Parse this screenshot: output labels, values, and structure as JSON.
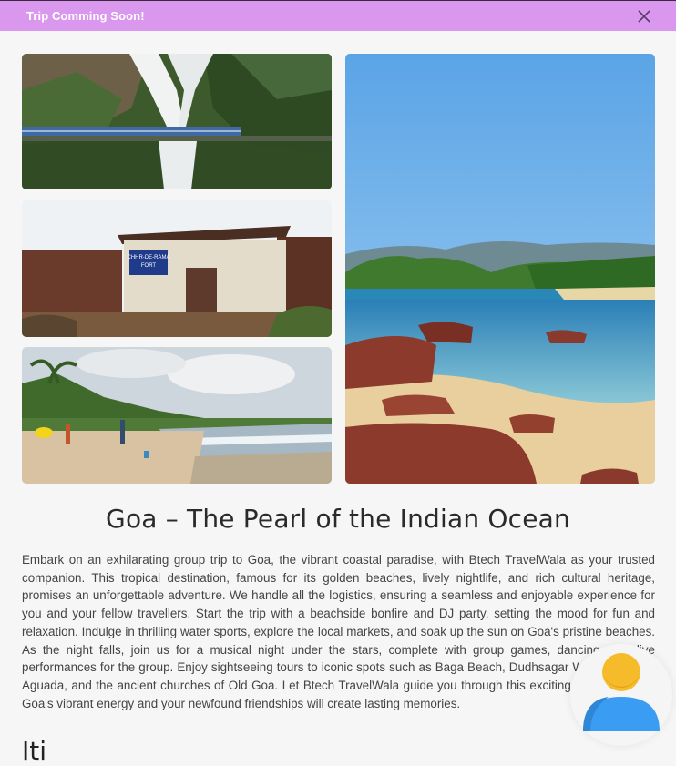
{
  "banner": {
    "text": "Trip Comming Soon!",
    "close_icon": "close-icon",
    "color": "#d998ee"
  },
  "gallery": [
    {
      "subject": "waterfall with train bridge",
      "icon": "photo"
    },
    {
      "subject": "fort gate building",
      "icon": "photo"
    },
    {
      "subject": "beach with palm trees",
      "icon": "photo"
    },
    {
      "subject": "rocky beach with turquoise sea",
      "icon": "photo"
    }
  ],
  "fort_sign": {
    "line1": "CHHR-DE-RAMA",
    "line2": "FORT"
  },
  "article": {
    "title": "Goa – The Pearl of the Indian Ocean",
    "description": "Embark on an exhilarating group trip to Goa, the vibrant coastal paradise, with Btech TravelWala as your trusted companion. This tropical destination, famous for its golden beaches, lively nightlife, and rich cultural heritage, promises an unforgettable adventure. We handle all the logistics, ensuring a seamless and enjoyable experience for you and your fellow travellers. Start the trip with a beachside bonfire and DJ party, setting the mood for fun and relaxation. Indulge in thrilling water sports, explore the local markets, and soak up the sun on Goa's pristine beaches. As the night falls, join us for a musical night under the stars, complete with group games, dancing, and live performances for the group. Enjoy sightseeing tours to iconic spots such as Baga Beach, Dudhsagar Waterfalls, Fort Aguada, and the ancient churches of Old Goa. Let Btech TravelWala guide you through this exciting journey, where Goa's vibrant energy and your newfound friendships will create lasting memories.",
    "next_section": "Iti"
  },
  "profile": {
    "icon": "user-avatar-icon",
    "head_color": "#f5bb2b",
    "body_color": "#3a9cf2"
  }
}
